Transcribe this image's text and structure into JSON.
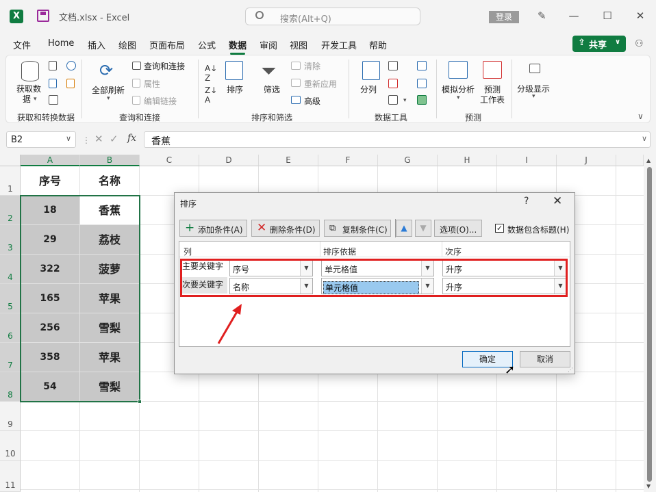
{
  "window": {
    "app_logo": "X",
    "title": "文档.xlsx  -  Excel",
    "search_placeholder": "搜索(Alt+Q)",
    "login": "登录",
    "icons": [
      "excel-logo-icon",
      "save-icon",
      "search-icon",
      "pen-icon",
      "minimize-icon",
      "maximize-icon",
      "close-icon"
    ]
  },
  "menu": {
    "items": [
      "文件",
      "Home",
      "插入",
      "绘图",
      "页面布局",
      "公式",
      "数据",
      "审阅",
      "视图",
      "开发工具",
      "帮助"
    ],
    "active": "数据",
    "share": "共享"
  },
  "ribbon": {
    "groups": [
      {
        "label": "获取和转换数据",
        "buttons": [
          "获取数据"
        ]
      },
      {
        "label": "查询和连接",
        "buttons": [
          "全部刷新",
          "查询和连接",
          "属性",
          "编辑链接"
        ]
      },
      {
        "label": "排序和筛选",
        "buttons": [
          "排序",
          "筛选",
          "清除",
          "重新应用",
          "高级"
        ]
      },
      {
        "label": "数据工具",
        "buttons": [
          "分列"
        ]
      },
      {
        "label": "预测",
        "buttons": [
          "模拟分析",
          "预测工作表"
        ]
      },
      {
        "label": "",
        "buttons": [
          "分级显示"
        ]
      }
    ],
    "get_data_l1": "获取数",
    "get_data_l2": "据",
    "forecast_l1": "预测",
    "forecast_l2": "工作表"
  },
  "formula_bar": {
    "name_box": "B2",
    "fx": "fx",
    "value": "香蕉"
  },
  "sheet": {
    "columns": [
      "A",
      "B",
      "C",
      "D",
      "E",
      "F",
      "G",
      "H",
      "I",
      "J"
    ],
    "rows": [
      "1",
      "2",
      "3",
      "4",
      "5",
      "6",
      "7",
      "8",
      "9",
      "10",
      "11"
    ],
    "header": [
      "序号",
      "名称"
    ],
    "data": [
      [
        "18",
        "香蕉"
      ],
      [
        "29",
        "荔枝"
      ],
      [
        "322",
        "菠萝"
      ],
      [
        "165",
        "苹果"
      ],
      [
        "256",
        "雪梨"
      ],
      [
        "358",
        "苹果"
      ],
      [
        "54",
        "雪梨"
      ]
    ]
  },
  "dialog": {
    "title": "排序",
    "help": "?",
    "add_level": "添加条件(A)",
    "delete_level": "删除条件(D)",
    "copy_level": "复制条件(C)",
    "options": "选项(O)...",
    "has_headers": "数据包含标题(H)",
    "has_headers_checked": true,
    "col_headers": [
      "列",
      "排序依据",
      "次序"
    ],
    "levels": [
      {
        "label": "主要关键字",
        "column": "序号",
        "sort_on": "单元格值",
        "order": "升序"
      },
      {
        "label": "次要关键字",
        "column": "名称",
        "sort_on": "单元格值",
        "order": "升序"
      }
    ],
    "ok": "确定",
    "cancel": "取消"
  },
  "colors": {
    "accent": "#107c41",
    "highlight_box": "#e01f1f",
    "selection": "#217346"
  }
}
